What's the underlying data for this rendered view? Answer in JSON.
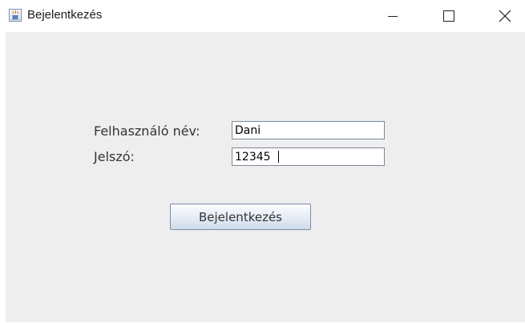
{
  "window": {
    "title": "Bejelentkezés",
    "icon": "java-cup-icon",
    "controls": {
      "minimize_icon": "minimize-icon",
      "maximize_icon": "maximize-icon",
      "close_icon": "close-icon"
    }
  },
  "form": {
    "username_label": "Felhasználó név:",
    "username_value": "Dani",
    "password_label": "Jelszó:",
    "password_value": "12345",
    "submit_label": "Bejelentkezés"
  },
  "colors": {
    "content_background": "#eeeeee",
    "field_border": "#7a8a99",
    "button_border": "#7a8ea8"
  }
}
